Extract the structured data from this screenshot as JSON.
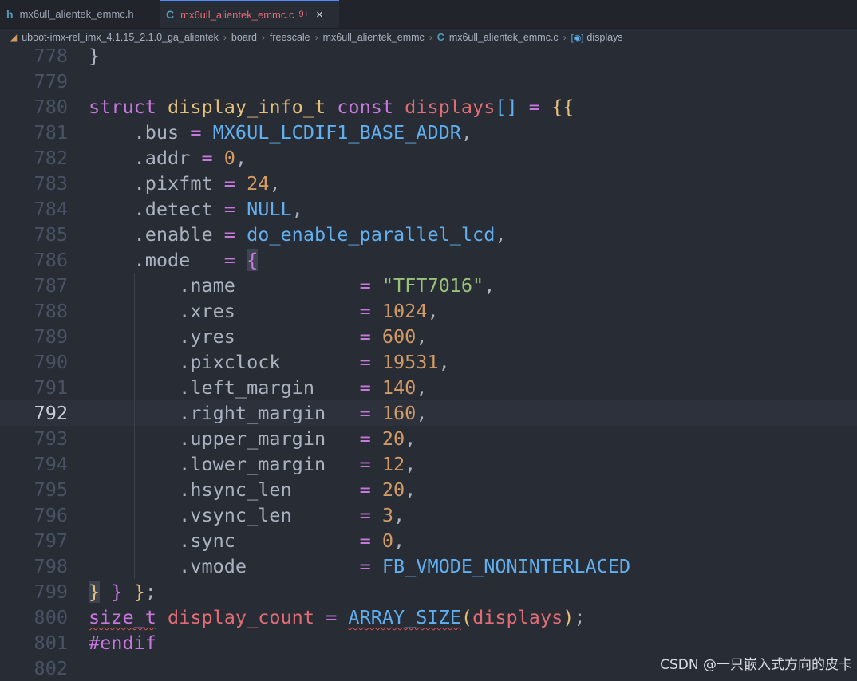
{
  "tabs": [
    {
      "icon": "h",
      "label": "mx6ull_alientek_emmc.h"
    },
    {
      "icon": "C",
      "label": "mx6ull_alientek_emmc.c",
      "badge": "9+",
      "close": "×"
    }
  ],
  "breadcrumb": {
    "items": [
      "uboot-imx-rel_imx_4.1.15_2.1.0_ga_alientek",
      "board",
      "freescale",
      "mx6ull_alientek_emmc",
      "mx6ull_alientek_emmc.c",
      "displays"
    ],
    "separator": "›"
  },
  "editor": {
    "current_line": "792",
    "lines": [
      {
        "num": "778",
        "tokens": [
          {
            "t": "}",
            "c": "plain"
          }
        ]
      },
      {
        "num": "779",
        "tokens": []
      },
      {
        "num": "780",
        "tokens": [
          {
            "t": "struct ",
            "c": "kw"
          },
          {
            "t": "display_info_t ",
            "c": "type"
          },
          {
            "t": "const ",
            "c": "kw"
          },
          {
            "t": "displays",
            "c": "var"
          },
          {
            "t": "[]",
            "c": "br3"
          },
          {
            "t": " = ",
            "c": "op"
          },
          {
            "t": "{",
            "c": "br1"
          },
          {
            "t": "{",
            "c": "br1"
          }
        ]
      },
      {
        "num": "781",
        "tokens": [
          {
            "t": "    .bus ",
            "c": "plain"
          },
          {
            "t": "= ",
            "c": "op"
          },
          {
            "t": "MX6UL_LCDIF1_BASE_ADDR",
            "c": "fn"
          },
          {
            "t": ",",
            "c": "plain"
          }
        ]
      },
      {
        "num": "782",
        "tokens": [
          {
            "t": "    .addr ",
            "c": "plain"
          },
          {
            "t": "= ",
            "c": "op"
          },
          {
            "t": "0",
            "c": "num"
          },
          {
            "t": ",",
            "c": "plain"
          }
        ]
      },
      {
        "num": "783",
        "tokens": [
          {
            "t": "    .pixfmt ",
            "c": "plain"
          },
          {
            "t": "= ",
            "c": "op"
          },
          {
            "t": "24",
            "c": "num"
          },
          {
            "t": ",",
            "c": "plain"
          }
        ]
      },
      {
        "num": "784",
        "tokens": [
          {
            "t": "    .detect ",
            "c": "plain"
          },
          {
            "t": "= ",
            "c": "op"
          },
          {
            "t": "NULL",
            "c": "fn"
          },
          {
            "t": ",",
            "c": "plain"
          }
        ]
      },
      {
        "num": "785",
        "tokens": [
          {
            "t": "    .enable ",
            "c": "plain"
          },
          {
            "t": "= ",
            "c": "op"
          },
          {
            "t": "do_enable_parallel_lcd",
            "c": "fn"
          },
          {
            "t": ",",
            "c": "plain"
          }
        ]
      },
      {
        "num": "786",
        "tokens": [
          {
            "t": "    .mode   ",
            "c": "plain"
          },
          {
            "t": "= ",
            "c": "op"
          },
          {
            "t": "{",
            "c": "br2 hl"
          }
        ]
      },
      {
        "num": "787",
        "tokens": [
          {
            "t": "        .name           ",
            "c": "plain"
          },
          {
            "t": "= ",
            "c": "op"
          },
          {
            "t": "\"TFT7016\"",
            "c": "str"
          },
          {
            "t": ",",
            "c": "plain"
          }
        ]
      },
      {
        "num": "788",
        "tokens": [
          {
            "t": "        .xres           ",
            "c": "plain"
          },
          {
            "t": "= ",
            "c": "op"
          },
          {
            "t": "1024",
            "c": "num"
          },
          {
            "t": ",",
            "c": "plain"
          }
        ]
      },
      {
        "num": "789",
        "tokens": [
          {
            "t": "        .yres           ",
            "c": "plain"
          },
          {
            "t": "= ",
            "c": "op"
          },
          {
            "t": "600",
            "c": "num"
          },
          {
            "t": ",",
            "c": "plain"
          }
        ]
      },
      {
        "num": "790",
        "tokens": [
          {
            "t": "        .pixclock       ",
            "c": "plain"
          },
          {
            "t": "= ",
            "c": "op"
          },
          {
            "t": "19531",
            "c": "num"
          },
          {
            "t": ",",
            "c": "plain"
          }
        ]
      },
      {
        "num": "791",
        "tokens": [
          {
            "t": "        .left_margin    ",
            "c": "plain"
          },
          {
            "t": "= ",
            "c": "op"
          },
          {
            "t": "140",
            "c": "num"
          },
          {
            "t": ",",
            "c": "plain"
          }
        ]
      },
      {
        "num": "792",
        "tokens": [
          {
            "t": "        .right_margin   ",
            "c": "plain"
          },
          {
            "t": "= ",
            "c": "op"
          },
          {
            "t": "160",
            "c": "num"
          },
          {
            "t": ",",
            "c": "plain"
          }
        ]
      },
      {
        "num": "793",
        "tokens": [
          {
            "t": "        .upper_margin   ",
            "c": "plain"
          },
          {
            "t": "= ",
            "c": "op"
          },
          {
            "t": "20",
            "c": "num"
          },
          {
            "t": ",",
            "c": "plain"
          }
        ]
      },
      {
        "num": "794",
        "tokens": [
          {
            "t": "        .lower_margin   ",
            "c": "plain"
          },
          {
            "t": "= ",
            "c": "op"
          },
          {
            "t": "12",
            "c": "num"
          },
          {
            "t": ",",
            "c": "plain"
          }
        ]
      },
      {
        "num": "795",
        "tokens": [
          {
            "t": "        .hsync_len      ",
            "c": "plain"
          },
          {
            "t": "= ",
            "c": "op"
          },
          {
            "t": "20",
            "c": "num"
          },
          {
            "t": ",",
            "c": "plain"
          }
        ]
      },
      {
        "num": "796",
        "tokens": [
          {
            "t": "        .vsync_len      ",
            "c": "plain"
          },
          {
            "t": "= ",
            "c": "op"
          },
          {
            "t": "3",
            "c": "num"
          },
          {
            "t": ",",
            "c": "plain"
          }
        ]
      },
      {
        "num": "797",
        "tokens": [
          {
            "t": "        .sync           ",
            "c": "plain"
          },
          {
            "t": "= ",
            "c": "op"
          },
          {
            "t": "0",
            "c": "num"
          },
          {
            "t": ",",
            "c": "plain"
          }
        ]
      },
      {
        "num": "798",
        "tokens": [
          {
            "t": "        .vmode          ",
            "c": "plain"
          },
          {
            "t": "= ",
            "c": "op"
          },
          {
            "t": "FB_VMODE_NONINTERLACED",
            "c": "fn"
          }
        ]
      },
      {
        "num": "799",
        "tokens": [
          {
            "t": "}",
            "c": "br1 hl"
          },
          {
            "t": " ",
            "c": "plain"
          },
          {
            "t": "}",
            "c": "br2"
          },
          {
            "t": " ",
            "c": "plain"
          },
          {
            "t": "}",
            "c": "br1"
          },
          {
            "t": ";",
            "c": "plain"
          }
        ]
      },
      {
        "num": "800",
        "tokens": [
          {
            "t": "size_t",
            "c": "kw squig"
          },
          {
            "t": " ",
            "c": "plain"
          },
          {
            "t": "display_count ",
            "c": "var"
          },
          {
            "t": "= ",
            "c": "op"
          },
          {
            "t": "ARRAY_SIZE",
            "c": "fn squig"
          },
          {
            "t": "(",
            "c": "br1"
          },
          {
            "t": "displays",
            "c": "var"
          },
          {
            "t": ")",
            "c": "br1"
          },
          {
            "t": ";",
            "c": "plain"
          }
        ]
      },
      {
        "num": "801",
        "tokens": [
          {
            "t": "#endif",
            "c": "kw"
          }
        ]
      },
      {
        "num": "802",
        "tokens": []
      }
    ]
  },
  "colors": {
    "background": "#282c34",
    "tabbar": "#21252b",
    "active_tab_text": "#e06c75",
    "keyword": "#c678dd",
    "type": "#e5c07b",
    "function": "#61afef",
    "number": "#d19a66",
    "string": "#98c379"
  },
  "watermark": "CSDN @一只嵌入式方向的皮卡"
}
